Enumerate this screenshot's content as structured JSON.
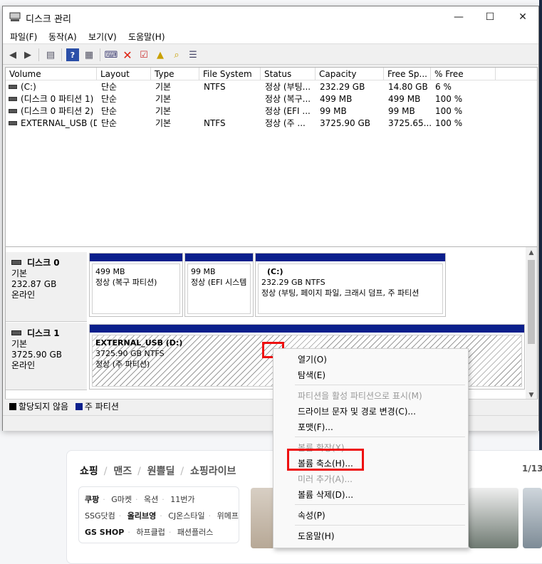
{
  "window": {
    "title": "디스크 관리",
    "minimize": "—",
    "maximize": "☐",
    "close": "✕"
  },
  "menu": [
    "파일(F)",
    "동작(A)",
    "보기(V)",
    "도움말(H)"
  ],
  "columns": [
    "Volume",
    "Layout",
    "Type",
    "File System",
    "Status",
    "Capacity",
    "Free Sp...",
    "% Free"
  ],
  "volumes": [
    {
      "volume": "(C:)",
      "layout": "단순",
      "type": "기본",
      "fs": "NTFS",
      "status": "정상 (부팅...",
      "capacity": "232.29 GB",
      "free": "14.80 GB",
      "pct": "6 %"
    },
    {
      "volume": "(디스크 0 파티션 1)",
      "layout": "단순",
      "type": "기본",
      "fs": "",
      "status": "정상 (복구...",
      "capacity": "499 MB",
      "free": "499 MB",
      "pct": "100 %"
    },
    {
      "volume": "(디스크 0 파티션 2)",
      "layout": "단순",
      "type": "기본",
      "fs": "",
      "status": "정상 (EFI ...",
      "capacity": "99 MB",
      "free": "99 MB",
      "pct": "100 %"
    },
    {
      "volume": "EXTERNAL_USB (D:)",
      "layout": "단순",
      "type": "기본",
      "fs": "NTFS",
      "status": "정상 (주 ...",
      "capacity": "3725.90 GB",
      "free": "3725.65...",
      "pct": "100 %"
    }
  ],
  "disks": [
    {
      "name": "디스크 0",
      "type": "기본",
      "size": "232.87 GB",
      "state": "온라인",
      "partitions": [
        {
          "title": "",
          "line1": "499 MB",
          "line2": "정상 (복구 파티션)"
        },
        {
          "title": "",
          "line1": "99 MB",
          "line2": "정상 (EFI 시스템"
        },
        {
          "title": "(C:)",
          "line1": "232.29 GB NTFS",
          "line2": "정상 (부팅, 페이지 파일, 크래시 덤프, 주 파티션"
        }
      ]
    },
    {
      "name": "디스크 1",
      "type": "기본",
      "size": "3725.90 GB",
      "state": "온라인",
      "partitions": [
        {
          "title": "EXTERNAL_USB  (D:)",
          "line1": "3725.90 GB NTFS",
          "line2": "정상 (주 파티션)"
        }
      ]
    }
  ],
  "legend": [
    "할당되지 않음",
    "주 파티션"
  ],
  "context_menu": [
    {
      "label": "열기(O)",
      "enabled": true
    },
    {
      "label": "탐색(E)",
      "enabled": true
    },
    {
      "label": "파티션을 활성 파티션으로 표시(M)",
      "enabled": false
    },
    {
      "label": "드라이브 문자 및 경로 변경(C)...",
      "enabled": true
    },
    {
      "label": "포맷(F)...",
      "enabled": true
    },
    {
      "label": "볼륨 확장(X)...",
      "enabled": false
    },
    {
      "label": "볼륨 축소(H)...",
      "enabled": true
    },
    {
      "label": "미러 추가(A)...",
      "enabled": false
    },
    {
      "label": "볼륨 삭제(D)...",
      "enabled": true
    },
    {
      "label": "속성(P)",
      "enabled": true
    },
    {
      "label": "도움말(H)",
      "enabled": true
    }
  ],
  "background": {
    "tabs": [
      "쇼핑",
      "맨즈",
      "원쁠딜",
      "쇼핑라이브"
    ],
    "pager": "1/13",
    "shop_rows": [
      [
        "쿠팡",
        "G마켓",
        "옥션",
        "11번가"
      ],
      [
        "SSG닷컴",
        "올리브영",
        "CJ온스타일",
        "위메프"
      ],
      [
        "GS SHOP",
        "하프클럽",
        "패션플러스"
      ]
    ]
  },
  "colors": {
    "partition_bar": "#0a1f8c",
    "highlight": "#ee1010",
    "unallocated": "#000000"
  }
}
